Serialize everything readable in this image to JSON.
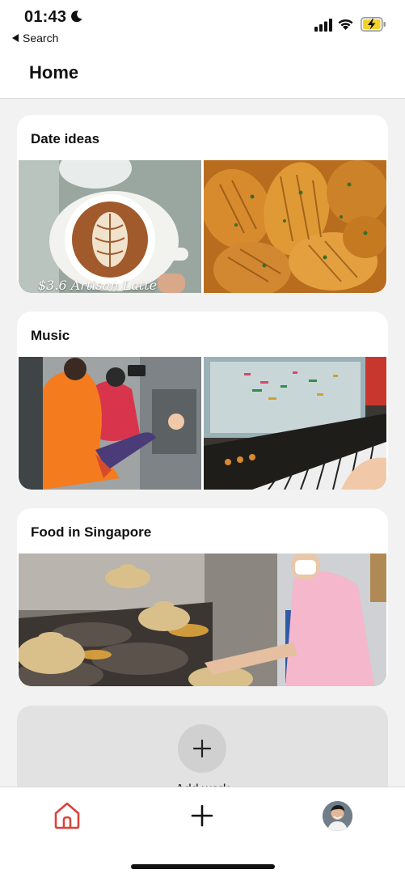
{
  "status_bar": {
    "time": "01:43",
    "back_label": "Search"
  },
  "header": {
    "title": "Home"
  },
  "collections": [
    {
      "title": "Date ideas",
      "photos": [
        {
          "description": "latte art coffee cup",
          "caption": "$3.6 Artisan Latte"
        },
        {
          "description": "hasselback potatoes"
        }
      ]
    },
    {
      "title": "Music",
      "photos": [
        {
          "description": "people in orange hoodies filming"
        },
        {
          "description": "keyboard and music software"
        }
      ]
    },
    {
      "title": "Food in Singapore",
      "photos": [
        {
          "description": "claypot rice stall"
        }
      ]
    }
  ],
  "add_card": {
    "label": "Add work"
  },
  "bottom_nav": {
    "items": [
      "home-icon",
      "add-icon",
      "profile-avatar"
    ]
  },
  "colors": {
    "accent": "#d9443b",
    "card_bg": "#ffffff",
    "page_bg": "#f2f2f2",
    "add_card_bg": "#e2e2e2"
  }
}
